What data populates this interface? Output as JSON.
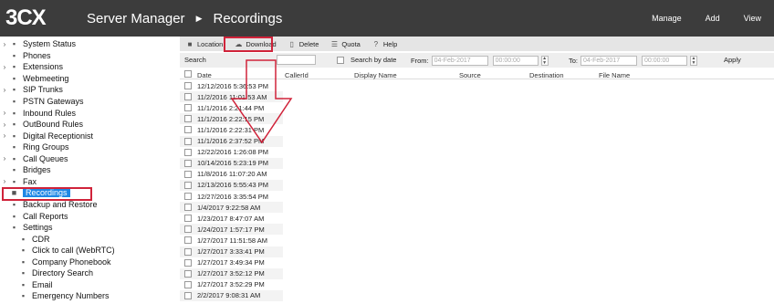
{
  "header": {
    "logo": "3CX",
    "app": "Server Manager",
    "page": "Recordings",
    "nav": [
      "Manage",
      "Add",
      "View"
    ]
  },
  "sidebar": {
    "items": [
      {
        "label": "System Status",
        "caret": true,
        "icon": "status-icon"
      },
      {
        "label": "Phones",
        "caret": false,
        "icon": "phone-icon"
      },
      {
        "label": "Extensions",
        "caret": true,
        "icon": "user-icon"
      },
      {
        "label": "Webmeeting",
        "caret": false,
        "icon": "webmeeting-icon"
      },
      {
        "label": "SIP Trunks",
        "caret": true,
        "icon": "trunk-icon"
      },
      {
        "label": "PSTN Gateways",
        "caret": false,
        "icon": "gateway-icon"
      },
      {
        "label": "Inbound Rules",
        "caret": true,
        "icon": "inbound-icon"
      },
      {
        "label": "OutBound Rules",
        "caret": true,
        "icon": "outbound-icon"
      },
      {
        "label": "Digital Receptionist",
        "caret": true,
        "icon": "receptionist-icon"
      },
      {
        "label": "Ring Groups",
        "caret": false,
        "icon": "group-icon"
      },
      {
        "label": "Call Queues",
        "caret": true,
        "icon": "queue-icon"
      },
      {
        "label": "Bridges",
        "caret": false,
        "icon": "bridge-icon"
      },
      {
        "label": "Fax",
        "caret": true,
        "icon": "fax-icon"
      },
      {
        "label": "Recordings",
        "caret": false,
        "icon": "recordings-icon",
        "active": true
      },
      {
        "label": "Backup and Restore",
        "caret": false,
        "icon": "backup-icon"
      },
      {
        "label": "Call Reports",
        "caret": false,
        "icon": "report-icon"
      },
      {
        "label": "Settings",
        "caret": false,
        "icon": "settings-icon"
      },
      {
        "label": "CDR",
        "caret": false,
        "icon": "cdr-icon",
        "sub": true
      },
      {
        "label": "Click to call (WebRTC)",
        "caret": false,
        "icon": "webrtc-icon",
        "sub": true
      },
      {
        "label": "Company Phonebook",
        "caret": false,
        "icon": "phonebook-icon",
        "sub": true
      },
      {
        "label": "Directory Search",
        "caret": false,
        "icon": "directory-icon",
        "sub": true
      },
      {
        "label": "Email",
        "caret": false,
        "icon": "email-icon",
        "sub": true
      },
      {
        "label": "Emergency Numbers",
        "caret": false,
        "icon": "emergency-icon",
        "sub": true
      }
    ]
  },
  "toolbar": {
    "location": "Location",
    "download": "Download",
    "delete": "Delete",
    "quota": "Quota",
    "help": "Help"
  },
  "filters": {
    "search_label": "Search",
    "search_value": "",
    "search_by_date": "Search by date",
    "from_label": "From:",
    "from_date": "04-Feb-2017",
    "from_time": "00:00:00",
    "to_label": "To:",
    "to_date": "04-Feb-2017",
    "to_time": "00:00:00",
    "apply": "Apply"
  },
  "table": {
    "columns": [
      "Date",
      "CallerId",
      "Display Name",
      "Source",
      "Destination",
      "File Name"
    ],
    "rows": [
      "12/12/2016 5:36:53 PM",
      "11/2/2016 11:01:53 AM",
      "11/1/2016 2:21:44 PM",
      "11/1/2016 2:22:15 PM",
      "11/1/2016 2:22:31 PM",
      "11/1/2016 2:37:52 PM",
      "12/22/2016 1:26:08 PM",
      "10/14/2016 5:23:19 PM",
      "11/8/2016 11:07:20 AM",
      "12/13/2016 5:55:43 PM",
      "12/27/2016 3:35:54 PM",
      "1/4/2017 9:22:58 AM",
      "1/23/2017 8:47:07 AM",
      "1/24/2017 1:57:17 PM",
      "1/27/2017 11:51:58 AM",
      "1/27/2017 3:33:41 PM",
      "1/27/2017 3:49:34 PM",
      "1/27/2017 3:52:12 PM",
      "1/27/2017 3:52:29 PM",
      "2/2/2017 9:08:31 AM"
    ]
  },
  "colors": {
    "header_bg": "#3c3c3c",
    "active_item": "#1e88e5",
    "annotation_red": "#d0233a"
  }
}
